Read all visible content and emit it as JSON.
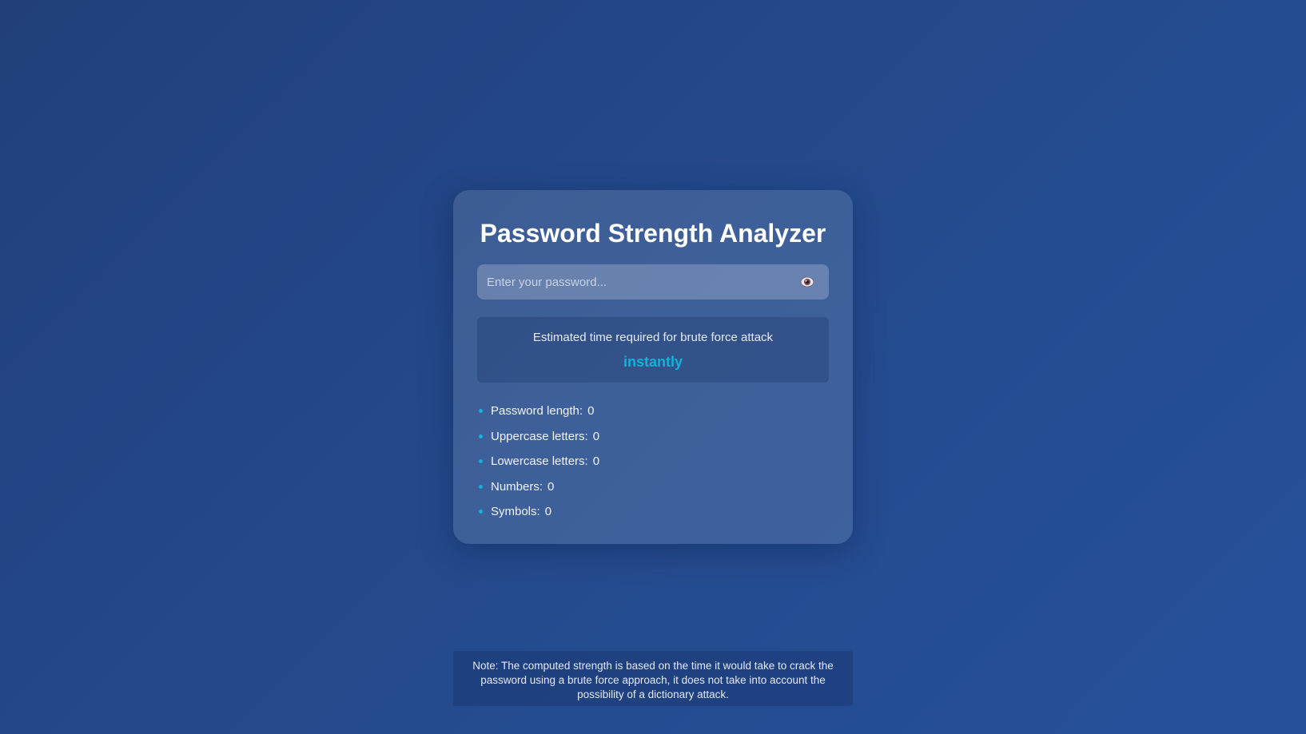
{
  "app": {
    "title": "Password Strength Analyzer"
  },
  "input": {
    "placeholder": "Enter your password...",
    "value": "",
    "toggle_icon": "eye-icon"
  },
  "result": {
    "label": "Estimated time required for brute force attack",
    "value": "instantly"
  },
  "stats": [
    {
      "label": "Password length:",
      "value": "0"
    },
    {
      "label": "Uppercase letters:",
      "value": "0"
    },
    {
      "label": "Lowercase letters:",
      "value": "0"
    },
    {
      "label": "Numbers:",
      "value": "0"
    },
    {
      "label": "Symbols:",
      "value": "0"
    }
  ],
  "note": {
    "text": "Note: The computed strength is based on the time it would take to crack the password using a brute force approach, it does not take into account the possibility of a dictionary attack."
  },
  "colors": {
    "accent": "#14b1d8",
    "background": "#234687"
  }
}
